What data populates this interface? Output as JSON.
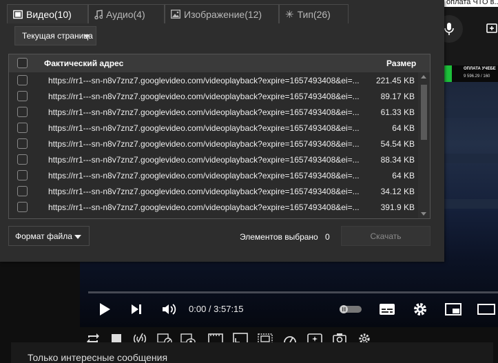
{
  "background": {
    "top_title": "оплата ЧТО в...",
    "bank_line1": "ОПЛАТА УЧЕБЕ",
    "bank_line2": "9 596.29 / 160",
    "player": {
      "time": "0:00 / 3:57:15",
      "progress": 0
    },
    "comments_text": "Только интересные сообщения"
  },
  "tabs": [
    {
      "label": "Видео(10)",
      "icon": "film-icon",
      "active": true
    },
    {
      "label": "Аудио(4)",
      "icon": "music-note-icon",
      "active": false
    },
    {
      "label": "Изображение(12)",
      "icon": "image-icon",
      "active": false
    },
    {
      "label": "Тип(26)",
      "icon": "asterisk-icon",
      "active": false
    }
  ],
  "scope_dropdown": {
    "value": "Текущая страница"
  },
  "table": {
    "header_address": "Фактический адрес",
    "header_size": "Размер",
    "rows": [
      {
        "url": "https://rr1---sn-n8v7znz7.googlevideo.com/videoplayback?expire=1657493408&ei=...",
        "size": "221.45 KB"
      },
      {
        "url": "https://rr1---sn-n8v7znz7.googlevideo.com/videoplayback?expire=1657493408&ei=...",
        "size": "89.17 KB"
      },
      {
        "url": "https://rr1---sn-n8v7znz7.googlevideo.com/videoplayback?expire=1657493408&ei=...",
        "size": "61.33 KB"
      },
      {
        "url": "https://rr1---sn-n8v7znz7.googlevideo.com/videoplayback?expire=1657493408&ei=...",
        "size": "64 KB"
      },
      {
        "url": "https://rr1---sn-n8v7znz7.googlevideo.com/videoplayback?expire=1657493408&ei=...",
        "size": "54.54 KB"
      },
      {
        "url": "https://rr1---sn-n8v7znz7.googlevideo.com/videoplayback?expire=1657493408&ei=...",
        "size": "88.34 KB"
      },
      {
        "url": "https://rr1---sn-n8v7znz7.googlevideo.com/videoplayback?expire=1657493408&ei=...",
        "size": "64 KB"
      },
      {
        "url": "https://rr1---sn-n8v7znz7.googlevideo.com/videoplayback?expire=1657493408&ei=...",
        "size": "34.12 KB"
      },
      {
        "url": "https://rr1---sn-n8v7znz7.googlevideo.com/videoplayback?expire=1657493408&ei=...",
        "size": "391.9 KB"
      }
    ]
  },
  "footer": {
    "format_label": "Формат файла",
    "selected_label": "Элементов выбрано",
    "selected_count": "0",
    "download_label": "Скачать"
  }
}
